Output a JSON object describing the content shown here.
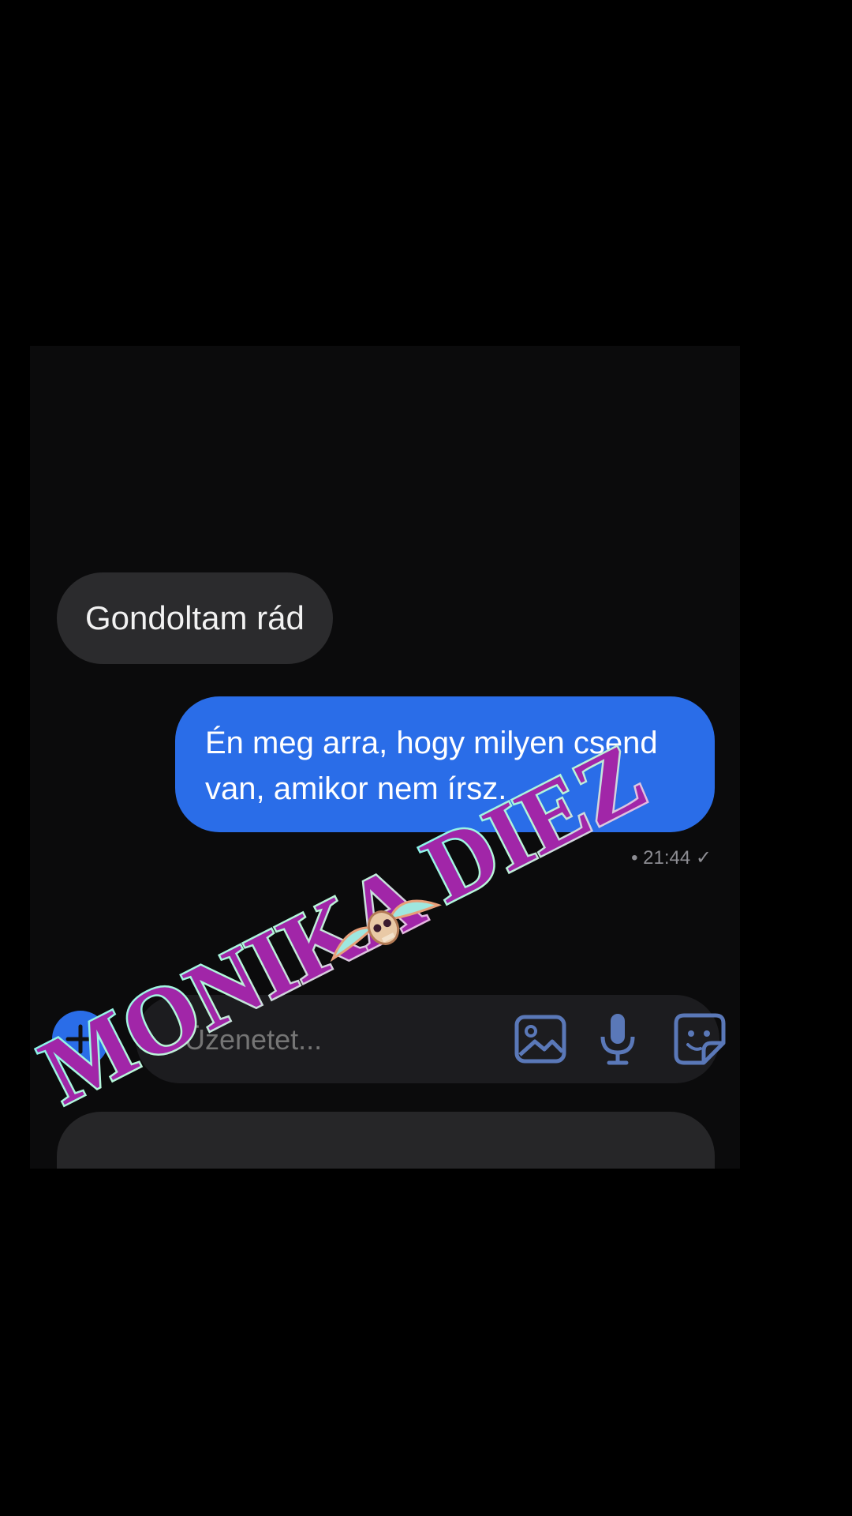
{
  "messages": [
    {
      "direction": "incoming",
      "text": "Gondoltam rád"
    },
    {
      "direction": "outgoing",
      "text": "Én meg arra, hogy milyen csend van, amikor nem írsz."
    }
  ],
  "status": {
    "time": "21:44",
    "separator": "•",
    "check": "✓"
  },
  "composer": {
    "placeholder": "Üzenetet...",
    "add_icon": "plus-icon",
    "gallery_icon": "image-icon",
    "voice_icon": "microphone-icon",
    "sticker_icon": "sticker-icon"
  },
  "watermark": {
    "left_word": "MONIKA",
    "right_word": "DIEZ"
  },
  "colors": {
    "background": "#000000",
    "screen": "#0b0b0c",
    "incoming_bubble": "#2b2b2d",
    "outgoing_bubble": "#2a6de8",
    "composer": "#1c1c1f",
    "icon": "#5a78b8"
  }
}
